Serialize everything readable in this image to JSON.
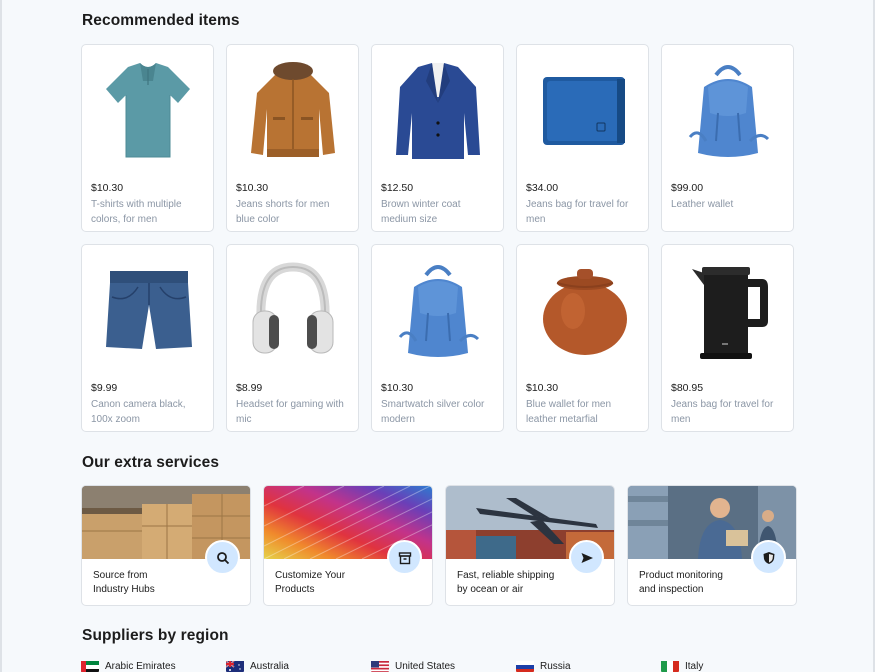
{
  "recommended": {
    "title": "Recommended items",
    "items": [
      {
        "price": "$10.30",
        "name": "T-shirts with multiple colors, for men",
        "icon": "tshirt-image"
      },
      {
        "price": "$10.30",
        "name": "Jeans shorts for men blue color",
        "icon": "jacket-image"
      },
      {
        "price": "$12.50",
        "name": "Brown winter coat medium size",
        "icon": "blazer-image"
      },
      {
        "price": "$34.00",
        "name": "Jeans bag for travel for men",
        "icon": "wallet-image"
      },
      {
        "price": "$99.00",
        "name": "Leather wallet",
        "icon": "backpack-image"
      },
      {
        "price": "$9.99",
        "name": "Canon camera black, 100x zoom",
        "icon": "shorts-image"
      },
      {
        "price": "$8.99",
        "name": "Headset for gaming with mic",
        "icon": "headphones-image"
      },
      {
        "price": "$10.30",
        "name": "Smartwatch silver color modern",
        "icon": "backpack-image"
      },
      {
        "price": "$10.30",
        "name": "Blue wallet for men leather metarfial",
        "icon": "clay-pot-image"
      },
      {
        "price": "$80.95",
        "name": "Jeans bag for travel for men",
        "icon": "kettle-image"
      }
    ]
  },
  "services": {
    "title": "Our extra services",
    "items": [
      {
        "line1": "Source from",
        "line2": "Industry Hubs",
        "icon": "search-icon"
      },
      {
        "line1": "Customize Your",
        "line2": "Products",
        "icon": "archive-box-icon"
      },
      {
        "line1": "Fast, reliable shipping",
        "line2": "by ocean or air",
        "icon": "send-icon"
      },
      {
        "line1": "Product monitoring",
        "line2": "and inspection",
        "icon": "shield-icon"
      }
    ]
  },
  "regions": {
    "title": "Suppliers by region",
    "items": [
      {
        "name": "Arabic Emirates",
        "flag": "uae-flag-icon"
      },
      {
        "name": "Australia",
        "flag": "australia-flag-icon"
      },
      {
        "name": "United States",
        "flag": "usa-flag-icon"
      },
      {
        "name": "Russia",
        "flag": "russia-flag-icon"
      },
      {
        "name": "Italy",
        "flag": "italy-flag-icon"
      }
    ]
  },
  "colors": {
    "accent_bg": "#d1e7ff",
    "border": "#dee2e7",
    "muted_text": "#8b96a5",
    "page_bg": "#f6f9fc"
  }
}
